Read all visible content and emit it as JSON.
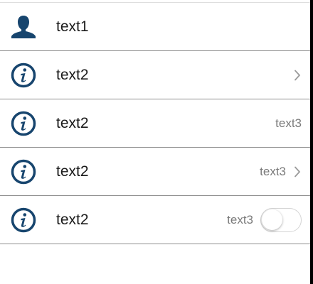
{
  "colors": {
    "accent": "#17456e",
    "divider": "#8e8e8e",
    "secondary_text": "#7a7a7a"
  },
  "rows": [
    {
      "icon": "person-icon",
      "title": "text1"
    },
    {
      "icon": "info-icon",
      "title": "text2",
      "accessory": "chevron"
    },
    {
      "icon": "info-icon",
      "title": "text2",
      "value": "text3"
    },
    {
      "icon": "info-icon",
      "title": "text2",
      "value": "text3",
      "accessory": "chevron"
    },
    {
      "icon": "info-icon",
      "title": "text2",
      "value": "text3",
      "accessory": "toggle",
      "toggle_on": false
    }
  ]
}
